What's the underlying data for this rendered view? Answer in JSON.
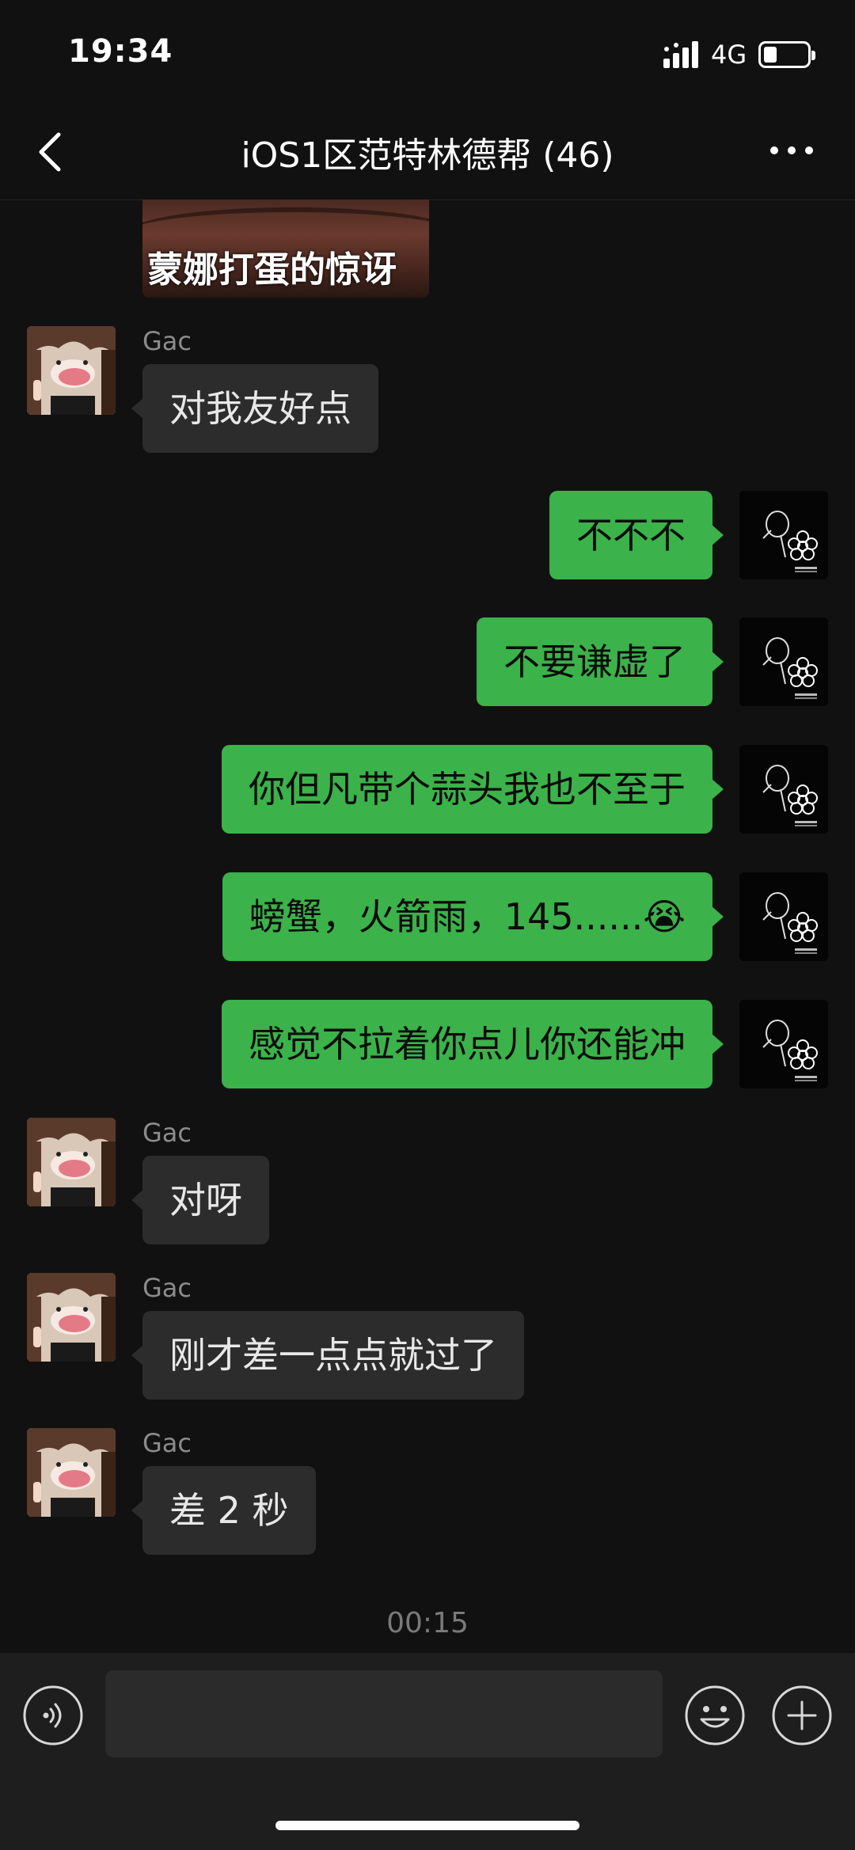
{
  "status_bar": {
    "time": "19:34",
    "network": "4G",
    "battery_level": 0.3
  },
  "nav": {
    "title": "iOS1区范特林德帮 (46)",
    "back_icon": "chevron-left-icon",
    "more_icon": "more-dots-icon"
  },
  "chat": {
    "image_caption": "蒙娜打蛋的惊讶",
    "messages": [
      {
        "side": "in",
        "sender": "Gac",
        "text": "对我友好点"
      },
      {
        "side": "out",
        "text": "不不不"
      },
      {
        "side": "out",
        "text": "不要谦虚了"
      },
      {
        "side": "out",
        "text": "你但凡带个蒜头我也不至于"
      },
      {
        "side": "out",
        "text": "螃蟹，火箭雨，145......😭"
      },
      {
        "side": "out",
        "text": "感觉不拉着你点儿你还能冲"
      },
      {
        "side": "in",
        "sender": "Gac",
        "text": "对呀"
      },
      {
        "side": "in",
        "sender": "Gac",
        "text": "刚才差一点点就过了"
      },
      {
        "side": "in",
        "sender": "Gac",
        "text": "差 2 秒"
      }
    ],
    "timestamp": "00:15"
  },
  "input_bar": {
    "voice_icon": "voice-icon",
    "text_value": "",
    "emoji_icon": "emoji-icon",
    "plus_icon": "plus-icon"
  },
  "colors": {
    "background": "#111111",
    "incoming_bubble": "#2c2c2c",
    "outgoing_bubble": "#3bb24a",
    "input_bar": "#1e1e1e"
  }
}
